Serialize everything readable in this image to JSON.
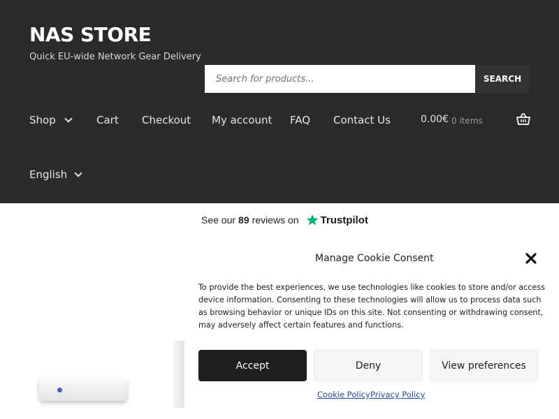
{
  "site": {
    "title": "NAS STORE",
    "tagline": "Quick EU-wide Network Gear Delivery"
  },
  "search": {
    "placeholder": "Search for products...",
    "button_label": "SEARCH"
  },
  "nav": {
    "items": [
      {
        "label": "Shop"
      },
      {
        "label": "Cart"
      },
      {
        "label": "Checkout"
      },
      {
        "label": "My account"
      },
      {
        "label": "FAQ"
      },
      {
        "label": "Contact Us"
      }
    ],
    "cart_total": "0.00€",
    "cart_count": "0 items",
    "language": "English"
  },
  "trustpilot": {
    "prefix": "See our",
    "count": "89",
    "suffix": "reviews on",
    "brand": "Trustpilot"
  },
  "cookie_modal": {
    "title": "Manage Cookie Consent",
    "body": "To provide the best experiences, we use technologies like cookies to store and/or access device information. Consenting to these technologies will allow us to process data such as browsing behavior or unique IDs on this site. Not consenting or withdrawing consent, may adversely affect certain features and functions.",
    "accept_label": "Accept",
    "deny_label": "Deny",
    "preferences_label": "View preferences",
    "cookie_policy_link": "Cookie Policy",
    "privacy_policy_link": "Privacy Policy"
  },
  "colors": {
    "header_bg": "#2a2a2c",
    "accept_bg": "#1e1e1e",
    "trustpilot_green": "#00b67a",
    "link": "#1f4fa3"
  }
}
